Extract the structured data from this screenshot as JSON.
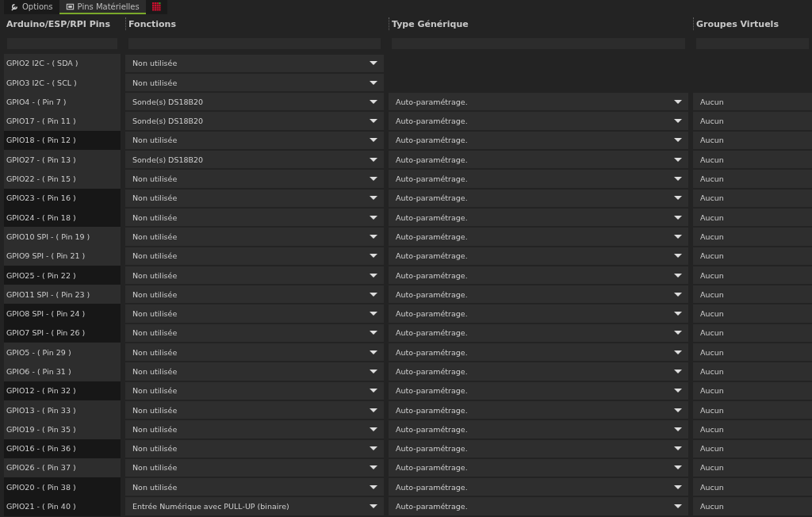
{
  "tabs": [
    {
      "label": "Options",
      "selected": false
    },
    {
      "label": "Pins Matérielles",
      "selected": true
    },
    {
      "selected": false
    }
  ],
  "table": {
    "columns": [
      "Arduino/ESP/RPI Pins",
      "Fonctions",
      "Type Générique",
      "Groupes Virtuels"
    ],
    "rows": [
      {
        "pin": "GPIO2 I2C - ( SDA )",
        "highlighted": false,
        "function": "Non utilisée"
      },
      {
        "pin": "GPIO3 I2C - ( SCL )",
        "highlighted": false,
        "function": "Non utilisée"
      },
      {
        "pin": "GPIO4 - ( Pin 7 )",
        "highlighted": false,
        "function": "Sonde(s) DS18B20",
        "type": "Auto-paramétrage.",
        "group": "Aucun"
      },
      {
        "pin": "GPIO17 - ( Pin 11 )",
        "highlighted": false,
        "function": "Sonde(s) DS18B20",
        "type": "Auto-paramétrage.",
        "group": "Aucun"
      },
      {
        "pin": "GPIO18 - ( Pin 12 )",
        "highlighted": true,
        "function": "Non utilisée",
        "type": "Auto-paramétrage.",
        "group": "Aucun"
      },
      {
        "pin": "GPIO27 - ( Pin 13 )",
        "highlighted": false,
        "function": "Sonde(s) DS18B20",
        "type": "Auto-paramétrage.",
        "group": "Aucun"
      },
      {
        "pin": "GPIO22 - ( Pin 15 )",
        "highlighted": false,
        "function": "Non utilisée",
        "type": "Auto-paramétrage.",
        "group": "Aucun"
      },
      {
        "pin": "GPIO23 - ( Pin 16 )",
        "highlighted": true,
        "function": "Non utilisée",
        "type": "Auto-paramétrage.",
        "group": "Aucun"
      },
      {
        "pin": "GPIO24 - ( Pin 18 )",
        "highlighted": true,
        "function": "Non utilisée",
        "type": "Auto-paramétrage.",
        "group": "Aucun"
      },
      {
        "pin": "GPIO10 SPI - ( Pin 19 )",
        "highlighted": false,
        "function": "Non utilisée",
        "type": "Auto-paramétrage.",
        "group": "Aucun"
      },
      {
        "pin": "GPIO9 SPI - ( Pin 21 )",
        "highlighted": false,
        "function": "Non utilisée",
        "type": "Auto-paramétrage.",
        "group": "Aucun"
      },
      {
        "pin": "GPIO25 - ( Pin 22 )",
        "highlighted": true,
        "function": "Non utilisée",
        "type": "Auto-paramétrage.",
        "group": "Aucun"
      },
      {
        "pin": "GPIO11 SPI - ( Pin 23 )",
        "highlighted": false,
        "function": "Non utilisée",
        "type": "Auto-paramétrage.",
        "group": "Aucun"
      },
      {
        "pin": "GPIO8 SPI - ( Pin 24 )",
        "highlighted": true,
        "function": "Non utilisée",
        "type": "Auto-paramétrage.",
        "group": "Aucun"
      },
      {
        "pin": "GPIO7 SPI - ( Pin 26 )",
        "highlighted": true,
        "function": "Non utilisée",
        "type": "Auto-paramétrage.",
        "group": "Aucun"
      },
      {
        "pin": "GPIO5 - ( Pin 29 )",
        "highlighted": false,
        "function": "Non utilisée",
        "type": "Auto-paramétrage.",
        "group": "Aucun"
      },
      {
        "pin": "GPIO6 - ( Pin 31 )",
        "highlighted": false,
        "function": "Non utilisée",
        "type": "Auto-paramétrage.",
        "group": "Aucun"
      },
      {
        "pin": "GPIO12 - ( Pin 32 )",
        "highlighted": true,
        "function": "Non utilisée",
        "type": "Auto-paramétrage.",
        "group": "Aucun"
      },
      {
        "pin": "GPIO13 - ( Pin 33 )",
        "highlighted": false,
        "function": "Non utilisée",
        "type": "Auto-paramétrage.",
        "group": "Aucun"
      },
      {
        "pin": "GPIO19 - ( Pin 35 )",
        "highlighted": false,
        "function": "Non utilisée",
        "type": "Auto-paramétrage.",
        "group": "Aucun"
      },
      {
        "pin": "GPIO16 - ( Pin 36 )",
        "highlighted": true,
        "function": "Non utilisée",
        "type": "Auto-paramétrage.",
        "group": "Aucun"
      },
      {
        "pin": "GPIO26 - ( Pin 37 )",
        "highlighted": false,
        "function": "Non utilisée",
        "type": "Auto-paramétrage.",
        "group": "Aucun"
      },
      {
        "pin": "GPIO20 - ( Pin 38 )",
        "highlighted": true,
        "function": "Non utilisée",
        "type": "Auto-paramétrage.",
        "group": "Aucun"
      },
      {
        "pin": "GPIO21 - ( Pin 40 )",
        "highlighted": true,
        "function": "Entrée Numérique avec PULL-UP (binaire)",
        "type": "Auto-paramétrage.",
        "group": "Aucun"
      }
    ]
  }
}
